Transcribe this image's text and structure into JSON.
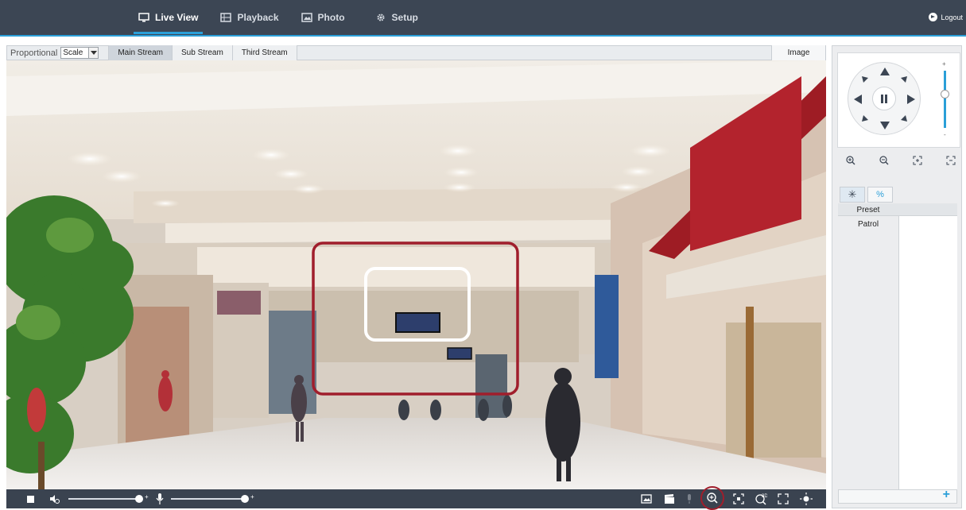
{
  "topnav": {
    "tabs": [
      {
        "label": "Live View",
        "icon": "monitor-icon",
        "active": true
      },
      {
        "label": "Playback",
        "icon": "film-icon",
        "active": false
      },
      {
        "label": "Photo",
        "icon": "photo-icon",
        "active": false
      },
      {
        "label": "Setup",
        "icon": "gear-icon",
        "active": false
      }
    ],
    "logout_label": "Logout"
  },
  "toolbar": {
    "display_mode_label": "Proportional",
    "scale_value": "Scale",
    "streams": [
      "Main Stream",
      "Sub Stream",
      "Third Stream"
    ],
    "active_stream": "Main Stream",
    "image_label": "Image"
  },
  "ptz_panel": {
    "speed_plus": "+",
    "speed_minus": "-",
    "tabs": [
      {
        "icon": "preset-star-icon"
      },
      {
        "icon": "patrol-icon"
      }
    ],
    "list_items": [
      "Preset",
      "Patrol"
    ],
    "add_label": "+"
  },
  "colors": {
    "accent": "#2b9fd8",
    "nav_bg": "#3c4654",
    "highlight_red": "#a01e2c"
  }
}
